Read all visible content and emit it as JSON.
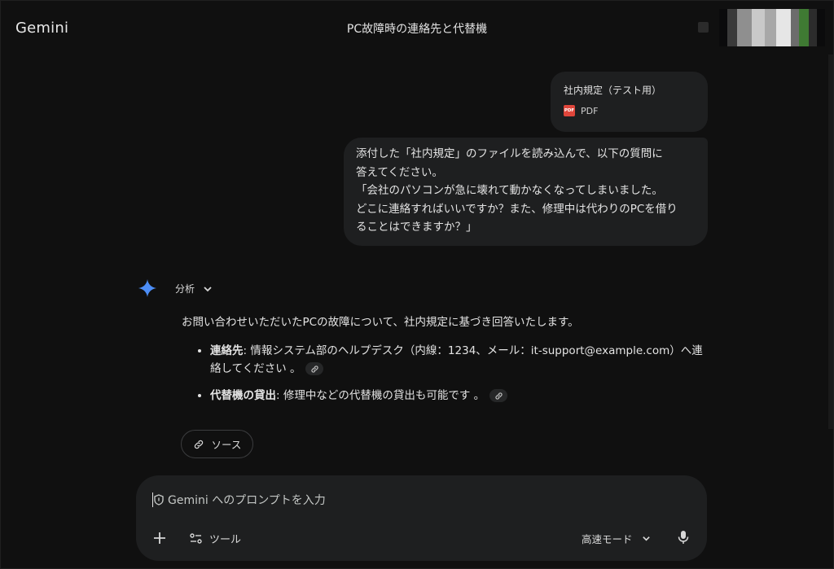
{
  "app": {
    "brand": "Gemini",
    "chat_title": "PC故障時の連絡先と代替機"
  },
  "attachment": {
    "name": "社内規定（テスト用）",
    "type_label": "PDF",
    "badge": "PDF"
  },
  "user_message": {
    "lines": "添付した「社内規定」のファイルを読み込んで、以下の質問に\n答えてください。\n「会社のパソコンが急に壊れて動かなくなってしまいました。\nどこに連絡すればいいですか？また、修理中は代わりのPCを借り\nることはできますか？」"
  },
  "response": {
    "analysis_label": "分析",
    "intro": "お問い合わせいただいたPCの故障について、社内規定に基づき回答いたします。",
    "bullets": [
      {
        "title": "連絡先",
        "text": ": 情報システム部のヘルプデスク（内線：1234、メール：it-support@example.com）へ連絡してください 。"
      },
      {
        "title": "代替機の貸出",
        "text": ": 修理中などの代替機の貸出も可能です 。"
      }
    ],
    "source_label": "ソース"
  },
  "composer": {
    "placeholder": "Gemini へのプロンプトを入力",
    "tools_label": "ツール",
    "mode_label": "高速モード"
  },
  "colors": {
    "accent_star": "#4c8df6",
    "pdf_red": "#e0463b"
  }
}
